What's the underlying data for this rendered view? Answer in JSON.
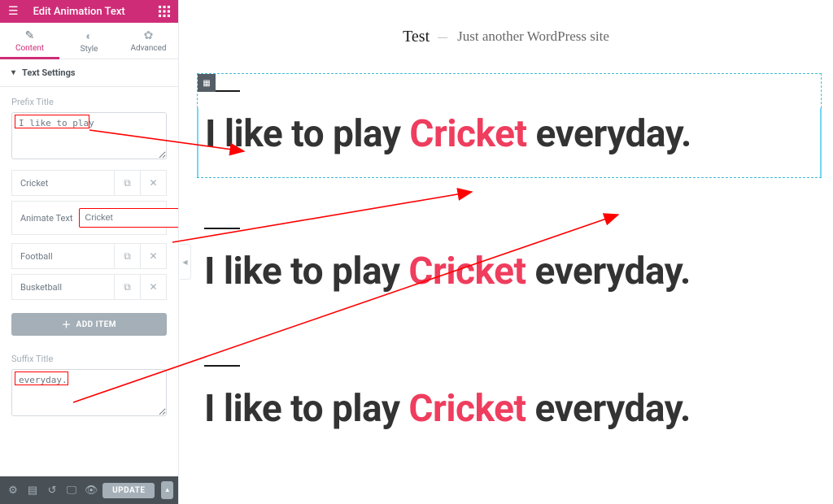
{
  "header": {
    "title": "Edit Animation Text"
  },
  "tabs": {
    "content": "Content",
    "style": "Style",
    "advanced": "Advanced"
  },
  "section": {
    "title": "Text Settings"
  },
  "prefix": {
    "label": "Prefix Title",
    "value": "I like to play"
  },
  "animate": {
    "label": "Animate Text",
    "open_value": "Cricket",
    "items": [
      {
        "title": "Cricket"
      },
      {
        "title": "Football"
      },
      {
        "title": "Busketball"
      }
    ]
  },
  "add_item_label": "ADD ITEM",
  "suffix": {
    "label": "Suffix Title",
    "value": "everyday."
  },
  "footer": {
    "update": "UPDATE"
  },
  "site": {
    "title": "Test",
    "tagline": "Just another WordPress site"
  },
  "preview": {
    "prefix": "I like to play ",
    "highlight": "Cricket",
    "suffix": " everyday."
  }
}
